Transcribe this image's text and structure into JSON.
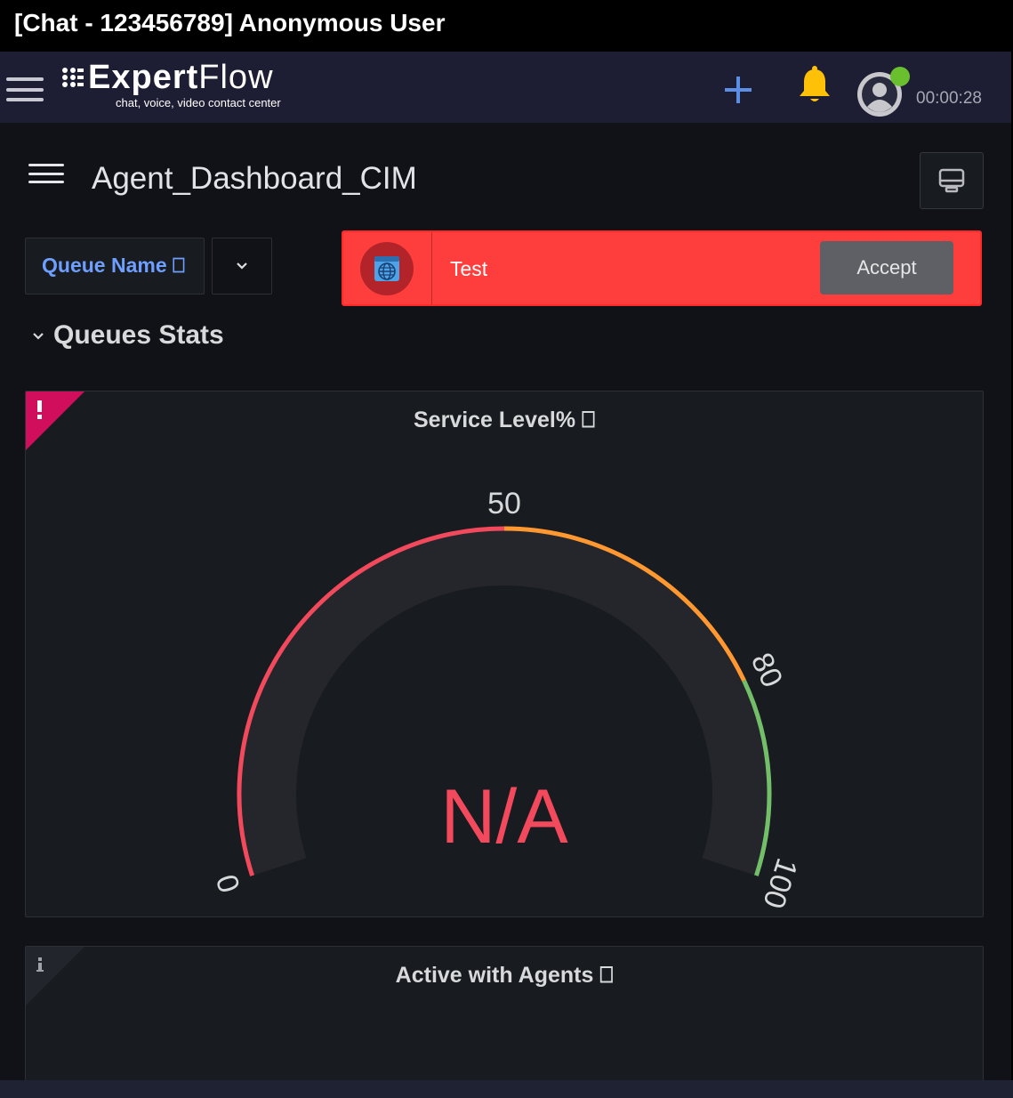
{
  "window": {
    "title": "[Chat - 123456789] Anonymous User"
  },
  "header": {
    "logo_brand_bold": "Expert",
    "logo_brand_light": "Flow",
    "logo_tagline": "chat, voice, video contact center",
    "timer": "00:00:28",
    "icons": [
      "menu-icon",
      "plus-icon",
      "bell-icon",
      "user-avatar-icon"
    ],
    "colors": {
      "header_bg": "#1d1d33",
      "bell": "#ffc107",
      "plus": "#5b8fe6",
      "presence": "#6abf2f"
    }
  },
  "dashboard": {
    "title": "Agent_Dashboard_CIM",
    "variable_label": "Queue Name ⎕",
    "variable_value": "",
    "row_title": "Queues Stats"
  },
  "notification": {
    "name": "Test",
    "accept_label": "Accept",
    "icon": "globe-icon",
    "colors": {
      "bg": "#fd3e3c",
      "button": "#5e6066"
    }
  },
  "panels": {
    "service_level": {
      "title": "Service Level% ⎕",
      "corner_icon": "alert-icon",
      "value_text": "N/A",
      "gauge": {
        "min": 0,
        "max": 100,
        "thresholds": [
          {
            "from": 0,
            "to": 50,
            "color": "#f2495c"
          },
          {
            "from": 50,
            "to": 80,
            "color": "#ff9830"
          },
          {
            "from": 80,
            "to": 100,
            "color": "#73bf69"
          }
        ],
        "tick_labels": [
          "0",
          "50",
          "80",
          "100"
        ]
      }
    },
    "active_with_agents": {
      "title": "Active with Agents ⎕",
      "corner_icon": "info-icon"
    }
  }
}
